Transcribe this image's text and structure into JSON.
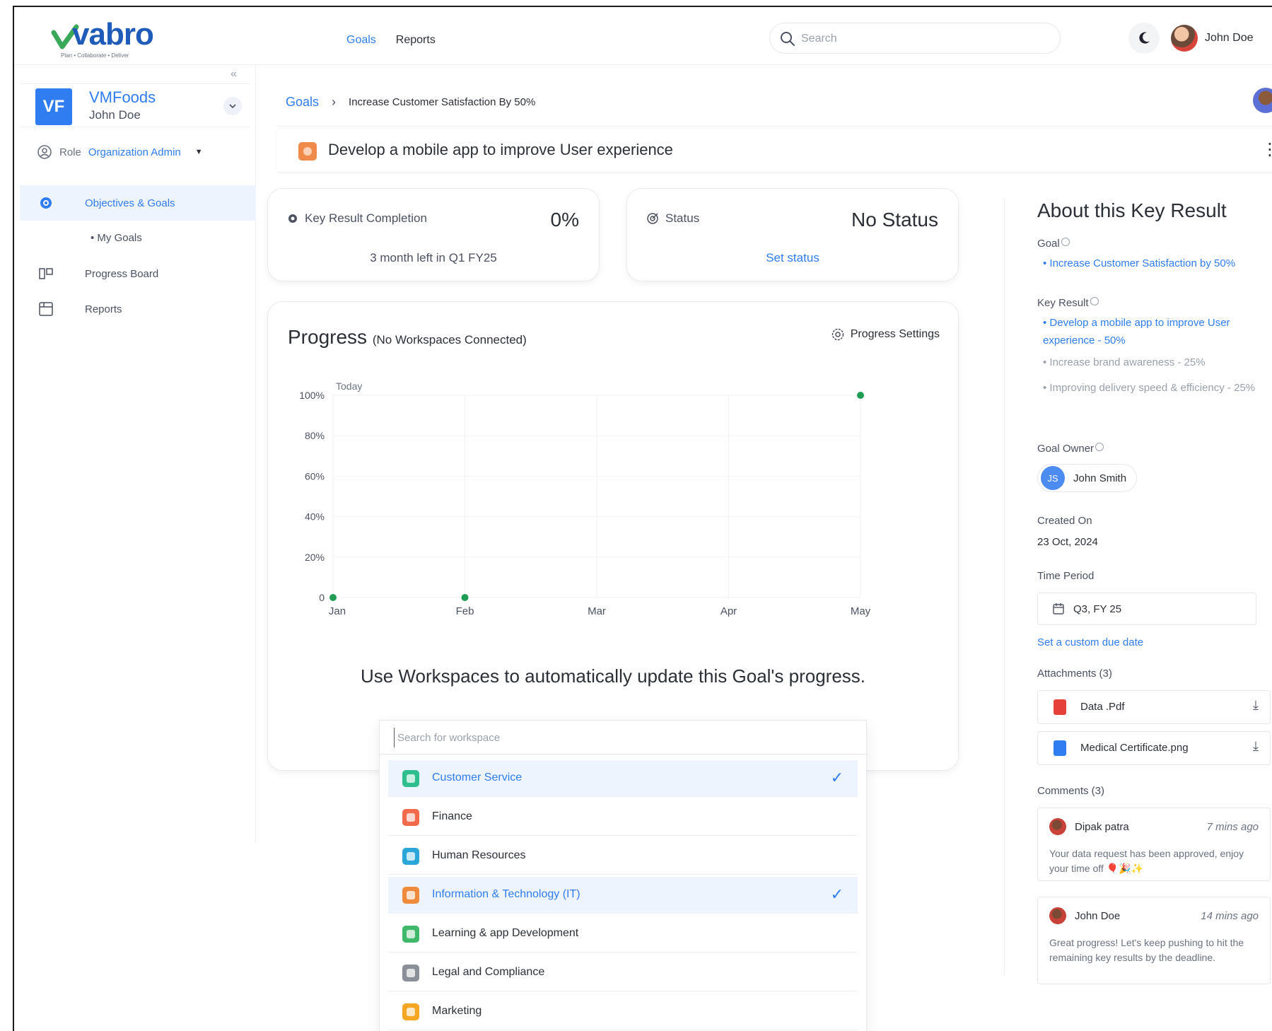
{
  "app": {
    "brand": "vabro",
    "tagline": "Plan • Collaborate • Deliver"
  },
  "topnav": {
    "goals": "Goals",
    "reports": "Reports"
  },
  "search": {
    "placeholder": "Search"
  },
  "user": {
    "name": "John Doe"
  },
  "sidebar": {
    "org_initials": "VF",
    "org_name": "VMFoods",
    "org_user": "John Doe",
    "role_label": "Role",
    "role_value": "Organization Admin",
    "items": [
      {
        "label": "Objectives & Goals"
      },
      {
        "label": "My Goals"
      },
      {
        "label": "Progress Board"
      },
      {
        "label": "Reports"
      }
    ]
  },
  "breadcrumb": {
    "root": "Goals",
    "current": "Increase Customer Satisfaction By 50%"
  },
  "page_title": "Develop a mobile app to improve User experience",
  "kpi": {
    "completion_label": "Key Result Completion",
    "completion_value": "0%",
    "completion_sub": "3 month left in Q1 FY25",
    "status_label": "Status",
    "status_value": "No Status",
    "status_link": "Set status"
  },
  "progress": {
    "title": "Progress",
    "subtitle": "(No Workspaces Connected)",
    "settings_label": "Progress Settings",
    "cta": "Use Workspaces to automatically update this Goal's progress."
  },
  "chart_data": {
    "type": "line",
    "categories": [
      "Jan",
      "Feb",
      "Mar",
      "Apr",
      "May"
    ],
    "y_ticks": [
      "0",
      "20%",
      "40%",
      "60%",
      "80%",
      "100%"
    ],
    "ylim": [
      0,
      100
    ],
    "grid": true,
    "today_label": "Today",
    "points": [
      {
        "x": "Jan",
        "y": 0
      },
      {
        "x": "Feb",
        "y": 0
      },
      {
        "x": "May",
        "y": 100
      }
    ],
    "point_color": "#1f9d55"
  },
  "workspace_picker": {
    "placeholder": "Search for workspace",
    "items": [
      {
        "label": "Customer Service",
        "selected": true,
        "color": "#2fbf8f"
      },
      {
        "label": "Finance",
        "selected": false,
        "color": "#f06a4b"
      },
      {
        "label": "Human Resources",
        "selected": false,
        "color": "#2aa7d8"
      },
      {
        "label": "Information & Technology (IT)",
        "selected": true,
        "color": "#f08a3b"
      },
      {
        "label": "Learning & app Development",
        "selected": false,
        "color": "#3fb86a"
      },
      {
        "label": "Legal and Compliance",
        "selected": false,
        "color": "#8a8f98"
      },
      {
        "label": "Marketing",
        "selected": false,
        "color": "#f5a623"
      }
    ]
  },
  "about": {
    "title": "About this Key Result",
    "goal_label": "Goal",
    "goal_value": "Increase Customer Satisfaction by 50%",
    "key_result_label": "Key Result",
    "key_results": [
      "Develop a mobile app to improve User experience - 50%",
      "Increase brand awareness - 25%",
      "Improving delivery speed & efficiency - 25%"
    ],
    "owner_label": "Goal Owner",
    "owner_initials": "JS",
    "owner_name": "John Smith",
    "created_label": "Created On",
    "created_value": "23 Oct, 2024",
    "period_label": "Time Period",
    "period_value": "Q3, FY 25",
    "custom_due_link": "Set a custom due date",
    "attachments_label": "Attachments (3)",
    "attachments": [
      "Data .Pdf",
      "Medical Certificate.png"
    ],
    "comments_label": "Comments (3)",
    "comments": [
      {
        "author": "Dipak patra",
        "time": "7 mins ago",
        "text": "Your data request has been approved, enjoy your time off 🎈🎉✨"
      },
      {
        "author": "John Doe",
        "time": "14 mins ago",
        "text": "Great progress! Let's keep pushing to hit the remaining key results by the deadline."
      }
    ]
  }
}
